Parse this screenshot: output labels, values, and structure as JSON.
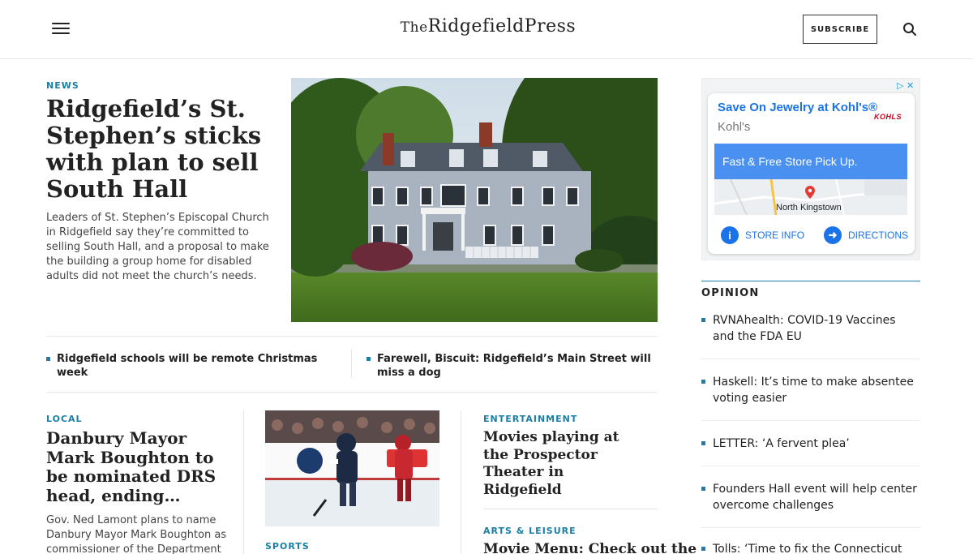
{
  "header": {
    "logo_the": "The",
    "logo_name": "RidgefieldPress",
    "subscribe_label": "SUBSCRIBE"
  },
  "lead": {
    "kicker": "NEWS",
    "title": "Ridgefield’s St. Stephen’s sticks with plan to sell South Hall",
    "dek": "Leaders of St. Stephen’s Episcopal Church in Ridgefield say they’re committed to selling South Hall, and a proposal to make the building a group home for disabled adults did not meet the church’s needs."
  },
  "related": [
    "Ridgefield schools will be remote Christmas week",
    "Farewell, Biscuit: Ridgefield’s Main Street will miss a dog"
  ],
  "local": {
    "kicker": "LOCAL",
    "title": "Danbury Mayor Mark Boughton to be nominated DRS head, ending…",
    "dek": "Gov. Ned Lamont plans to name Danbury Mayor Mark Boughton as commissioner of the Department of"
  },
  "sports": {
    "kicker": "SPORTS"
  },
  "entertainment": {
    "kicker": "ENTERTAINMENT",
    "title": "Movies playing at the Prospector Theater in Ridgefield"
  },
  "arts": {
    "kicker": "ARTS & LEISURE",
    "title": "Movie Menu: Check out the"
  },
  "ad": {
    "headline": "Save On Jewelry at Kohl's®",
    "brand": "Kohl's",
    "logo": "KOHLS",
    "banner": "Fast & Free Store Pick Up.",
    "map_label": "North Kingstown",
    "store_info": "STORE INFO",
    "directions": "DIRECTIONS"
  },
  "opinion": {
    "heading": "OPINION",
    "items": [
      "RVNAhealth: COVID-19 Vaccines and the FDA EU",
      "Haskell: It’s time to make absentee voting easier",
      "LETTER: ‘A fervent plea’",
      "Founders Hall event will help center overcome challenges",
      "Tolls: ‘Time to fix the Connecticut"
    ]
  },
  "colors": {
    "accent": "#1a7ea6",
    "ad_blue": "#1a73e8"
  }
}
